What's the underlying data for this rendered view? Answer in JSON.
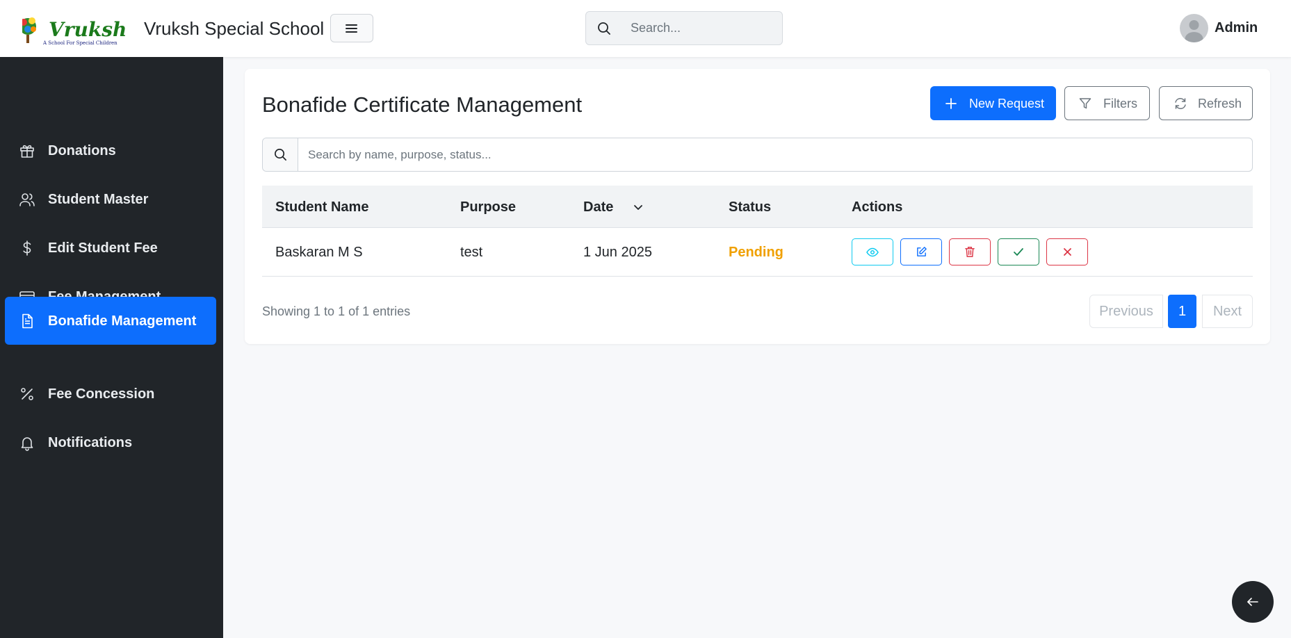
{
  "header": {
    "brand": "Vruksh Special School",
    "logo_text": "Vruksh",
    "logo_tagline": "A School For Special Children",
    "search_placeholder": "Search...",
    "user_name": "Admin"
  },
  "sidebar": {
    "items": [
      {
        "label": "Donations",
        "icon": "gift-icon",
        "active": false
      },
      {
        "label": "Student Master",
        "icon": "users-icon",
        "active": false
      },
      {
        "label": "Edit Student Fee",
        "icon": "dollar-icon",
        "active": false
      },
      {
        "label": "Fee Management",
        "icon": "card-icon",
        "active": false
      },
      {
        "label": "Bonafide Management",
        "icon": "document-icon",
        "active": true
      },
      {
        "label": "Fee Concession",
        "icon": "percent-icon",
        "active": false
      },
      {
        "label": "Notifications",
        "icon": "bell-icon",
        "active": false
      }
    ]
  },
  "main": {
    "title": "Bonafide Certificate Management",
    "buttons": {
      "new_request": "New Request",
      "filters": "Filters",
      "refresh": "Refresh"
    },
    "table_search_placeholder": "Search by name, purpose, status...",
    "columns": [
      "Student Name",
      "Purpose",
      "Date",
      "Status",
      "Actions"
    ],
    "rows": [
      {
        "student_name": "Baskaran M S",
        "purpose": "test",
        "date": "1 Jun 2025",
        "status": "Pending"
      }
    ],
    "info": "Showing 1 to 1 of 1 entries",
    "pagination": {
      "previous": "Previous",
      "current": "1",
      "next": "Next"
    }
  },
  "colors": {
    "primary": "#0d6efd",
    "sidebar_bg": "#212529",
    "pending": "#f0a000",
    "view": "#0dcaf0",
    "edit": "#0d6efd",
    "delete": "#dc3545",
    "approve": "#198754",
    "reject": "#dc3545"
  }
}
